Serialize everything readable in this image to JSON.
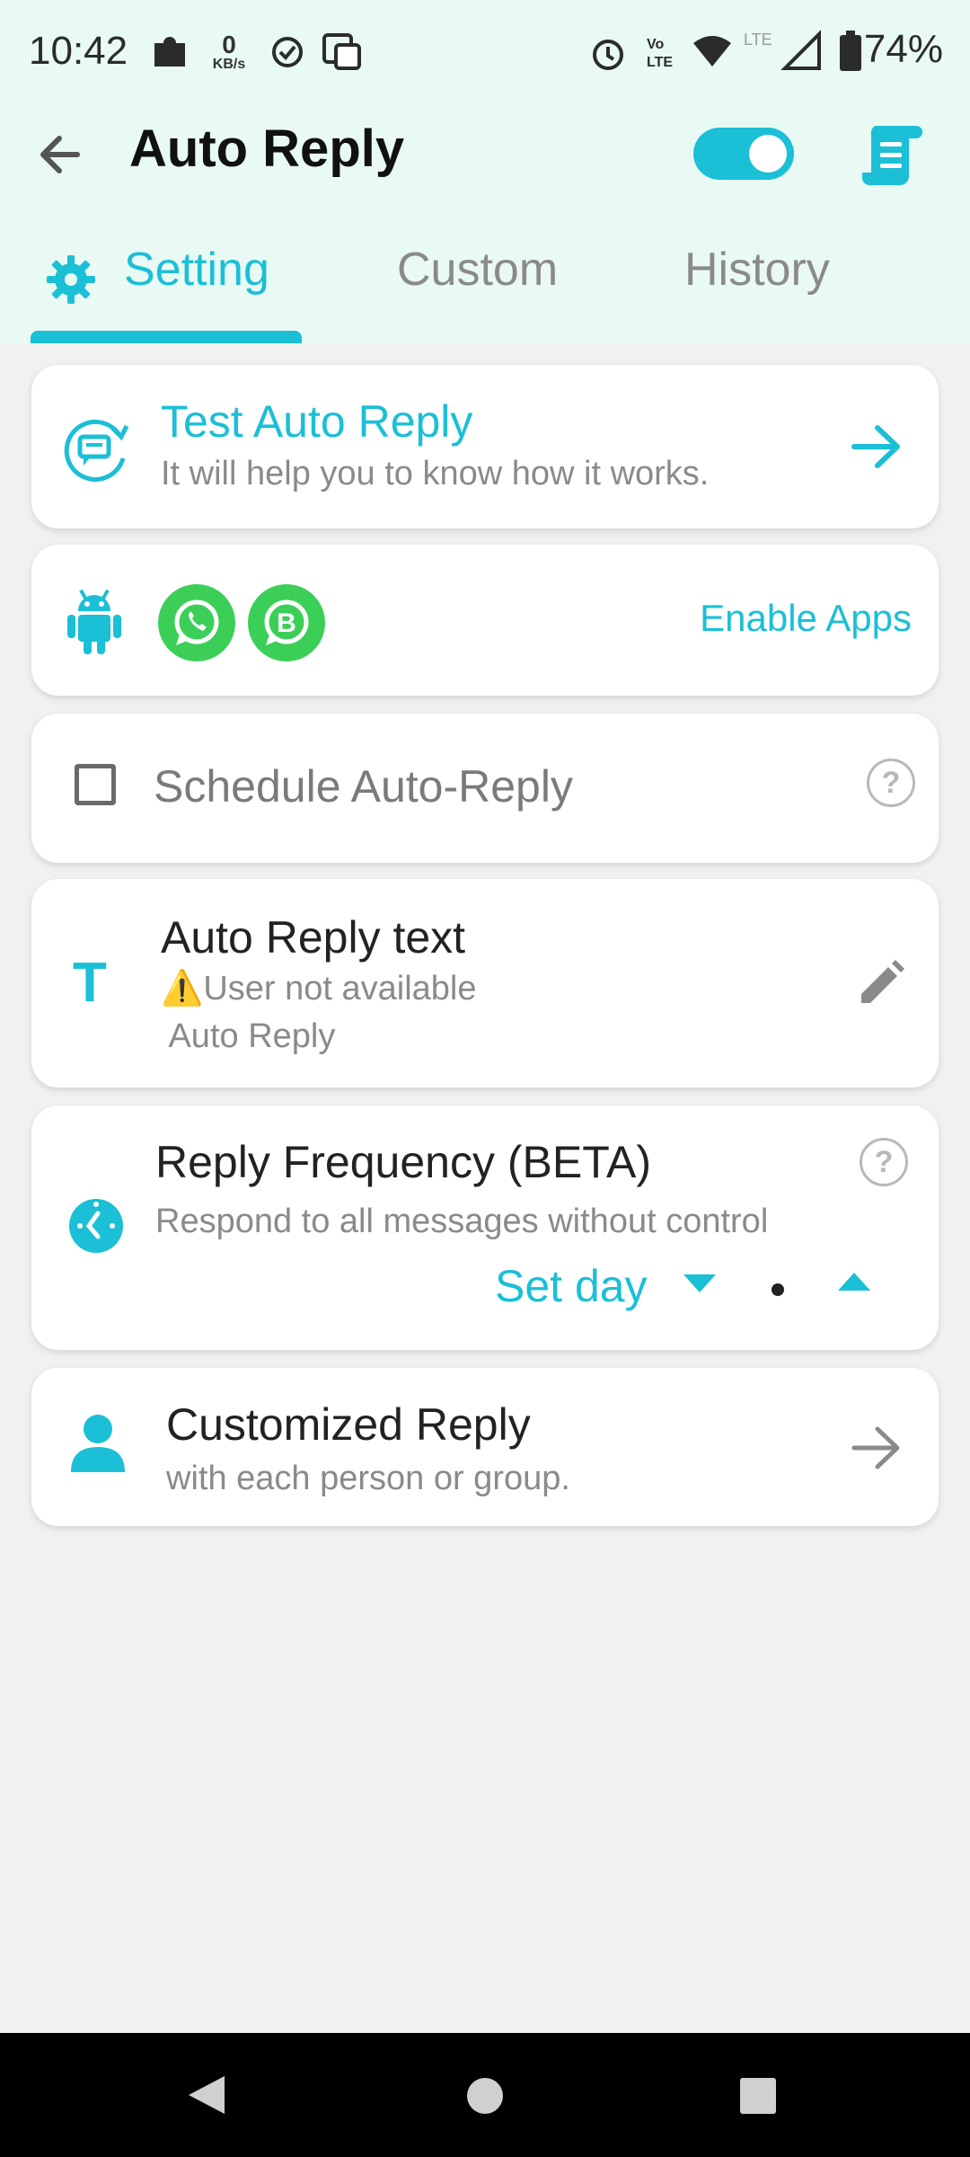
{
  "status_bar": {
    "time": "10:42",
    "speed_value": "0",
    "speed_unit": "KB/s",
    "battery": "74%"
  },
  "toolbar": {
    "title": "Auto Reply",
    "toggle_on": true
  },
  "tabs": [
    {
      "label": "Setting",
      "active": true
    },
    {
      "label": "Custom",
      "active": false
    },
    {
      "label": "History",
      "active": false
    }
  ],
  "test_card": {
    "title": "Test Auto Reply",
    "subtitle": "It will help you to know how it works."
  },
  "apps_card": {
    "enable_label": "Enable Apps",
    "app_icons": [
      "android-icon",
      "whatsapp-icon",
      "whatsapp-business-icon"
    ]
  },
  "schedule_card": {
    "label": "Schedule Auto-Reply",
    "checked": false
  },
  "reply_text_card": {
    "title": "Auto Reply text",
    "line1": "⚠️User not available",
    "line2": " Auto Reply"
  },
  "frequency_card": {
    "title": "Reply Frequency (BETA)",
    "subtitle": "Respond to all messages without control",
    "set_day_label": "Set day"
  },
  "customized_card": {
    "title": "Customized Reply",
    "subtitle": "with each person or group."
  },
  "colors": {
    "accent": "#1bbfd6",
    "header_bg": "#e8faf3",
    "page_bg": "#f1f1f1",
    "whatsapp_green": "#3ccf58"
  }
}
